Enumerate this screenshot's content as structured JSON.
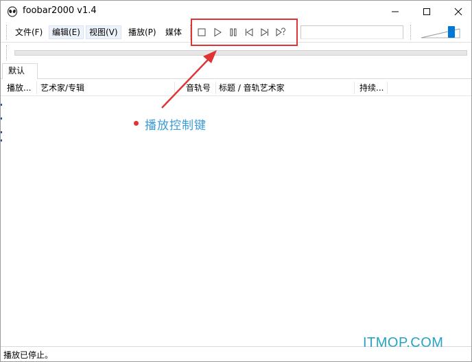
{
  "window": {
    "title": "foobar2000 v1.4"
  },
  "menu": {
    "items": [
      {
        "label": "文件(F)"
      },
      {
        "label": "编辑(E)"
      },
      {
        "label": "视图(V)"
      },
      {
        "label": "播放(P)"
      },
      {
        "label": "媒体"
      }
    ]
  },
  "toolbar": {
    "buttons": [
      "stop-icon",
      "play-icon",
      "pause-icon",
      "previous-icon",
      "next-icon",
      "random-icon"
    ]
  },
  "tabs": [
    {
      "label": "默认"
    }
  ],
  "list": {
    "columns": [
      {
        "label": "播放..."
      },
      {
        "label": "艺术家/专辑"
      },
      {
        "label": "音轨号"
      },
      {
        "label": "标题 / 音轨艺术家"
      },
      {
        "label": "持续..."
      }
    ]
  },
  "annotation": {
    "text": "播放控制键"
  },
  "watermark": {
    "text": "ITMOP.COM"
  },
  "status": {
    "text": "播放已停止。"
  },
  "colors": {
    "highlight": "#e03434",
    "annotation_text": "#3b9bd8",
    "accent": "#0078d7",
    "watermark": "#24a2c7"
  }
}
